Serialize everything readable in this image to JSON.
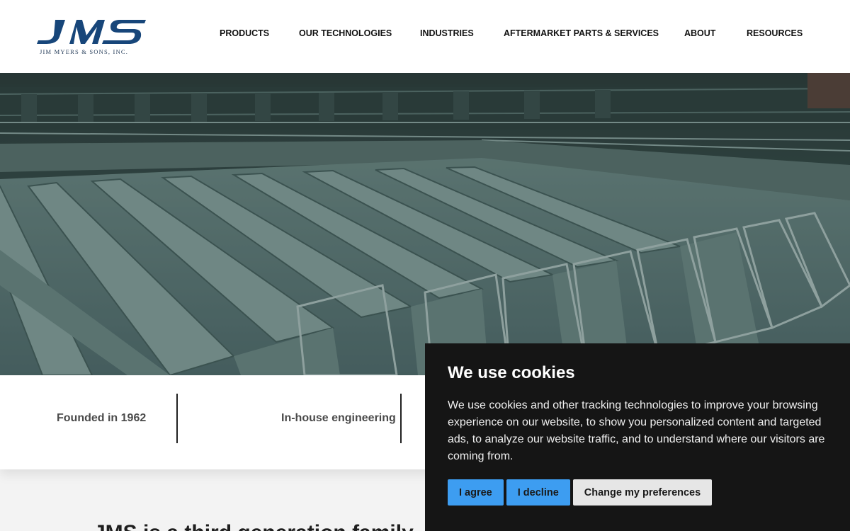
{
  "logo": {
    "mark": "JMS",
    "tagline": "JIM MYERS & SONS, INC.",
    "color": "#17467a"
  },
  "nav": {
    "items": [
      {
        "label": "PRODUCTS"
      },
      {
        "label": "OUR TECHNOLOGIES"
      },
      {
        "label": "INDUSTRIES"
      },
      {
        "label": "AFTERMARKET PARTS & SERVICES"
      },
      {
        "label": "ABOUT"
      },
      {
        "label": "RESOURCES"
      }
    ]
  },
  "hero": {
    "image": "wastewater-treatment-basins-photo",
    "overlay_color": "#3e5552"
  },
  "features": [
    {
      "label": "Founded in 1962"
    },
    {
      "label": "In-house engineering"
    }
  ],
  "lower_section": {
    "heading": "JMS is a third generation family..."
  },
  "cookie_banner": {
    "title": "We use cookies",
    "body": "We use cookies and other tracking technologies to improve your browsing experience on our website, to show you personalized content and targeted ads, to analyze our website traffic, and to understand where our visitors are coming from.",
    "agree_label": "I agree",
    "decline_label": "I decline",
    "preferences_label": "Change my preferences",
    "accent_color": "#3d9df1"
  }
}
